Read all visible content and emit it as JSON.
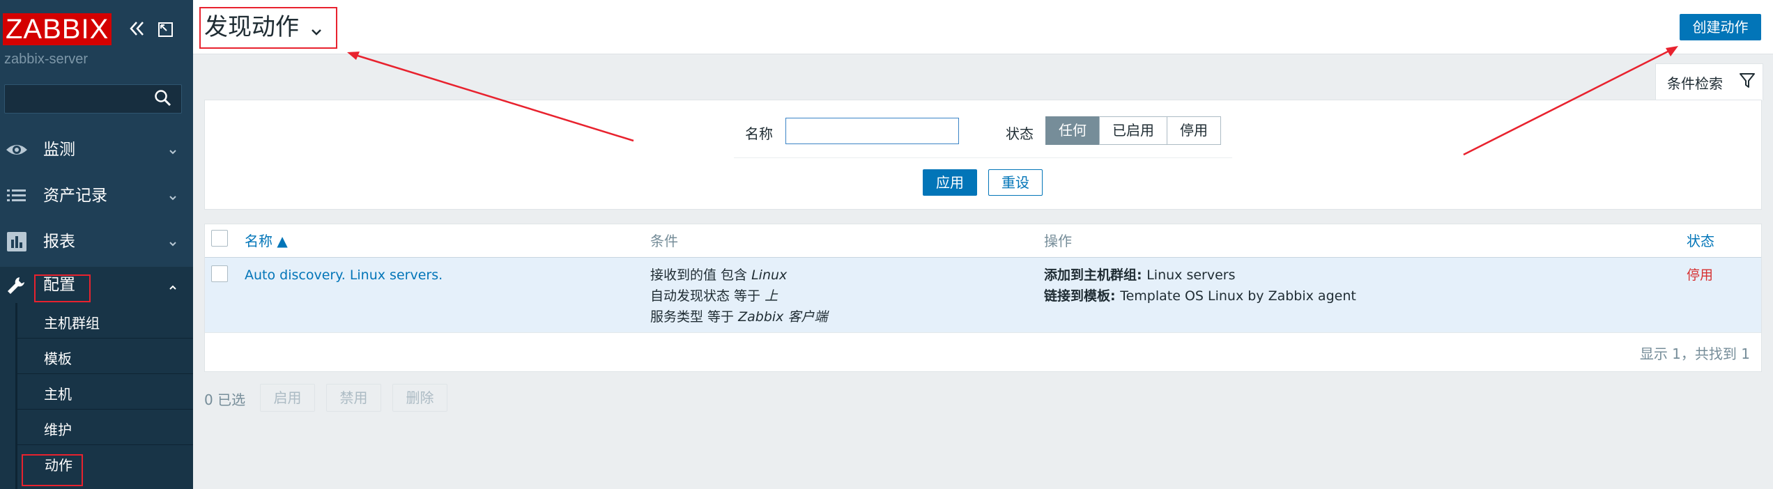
{
  "sidebar": {
    "logo": "ZABBIX",
    "server_name": "zabbix-server",
    "search_placeholder": "",
    "menu": [
      {
        "label": "监测",
        "icon": "eye-icon"
      },
      {
        "label": "资产记录",
        "icon": "list-icon"
      },
      {
        "label": "报表",
        "icon": "bar-chart-icon"
      },
      {
        "label": "配置",
        "icon": "wrench-icon"
      }
    ],
    "submenu": [
      "主机群组",
      "模板",
      "主机",
      "维护",
      "动作"
    ]
  },
  "header": {
    "title": "发现动作",
    "create_button": "创建动作"
  },
  "filter": {
    "tab_label": "条件检索",
    "name_label": "名称",
    "name_value": "",
    "status_label": "状态",
    "status_options": [
      "任何",
      "已启用",
      "停用"
    ],
    "status_selected": "任何",
    "apply": "应用",
    "reset": "重设"
  },
  "table": {
    "columns": {
      "name": "名称 ▲",
      "conditions": "条件",
      "operations": "操作",
      "status": "状态"
    },
    "rows": [
      {
        "name": "Auto discovery. Linux servers.",
        "conditions": [
          {
            "prefix": "接收到的值 包含 ",
            "value": "Linux"
          },
          {
            "prefix": "自动发现状态 等于 ",
            "value": "上"
          },
          {
            "prefix": "服务类型 等于 ",
            "value": "Zabbix 客户端"
          }
        ],
        "operations": [
          {
            "label": "添加到主机群组: ",
            "value": "Linux servers"
          },
          {
            "label": "链接到模板: ",
            "value": "Template OS Linux by Zabbix agent"
          }
        ],
        "status": "停用"
      }
    ],
    "summary": "显示 1，共找到 1"
  },
  "footer": {
    "selected": "0 已选",
    "buttons": [
      "启用",
      "禁用",
      "删除"
    ]
  },
  "colors": {
    "sidebar_bg": "#1f3f56",
    "accent": "#0275b8",
    "logo_red": "#d40000",
    "annotation_red": "#e8222e",
    "disabled_status": "#d63030"
  }
}
